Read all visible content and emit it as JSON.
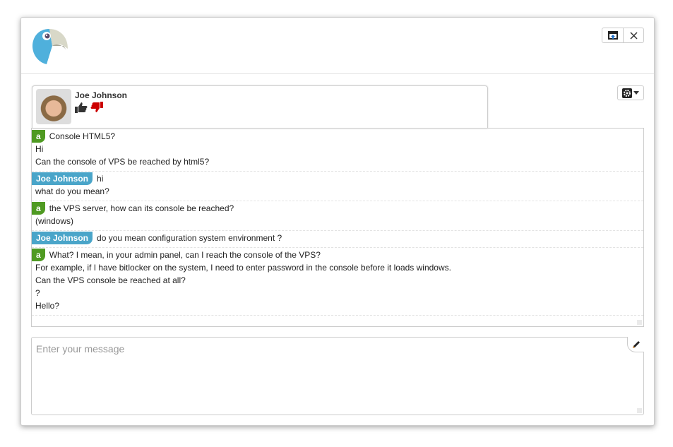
{
  "header": {
    "logo": "parrot-logo",
    "buttons": [
      {
        "icon": "popout-icon"
      },
      {
        "icon": "close-icon"
      }
    ]
  },
  "profile": {
    "name": "Joe Johnson",
    "thumbs_up": "thumbs-up-icon",
    "thumbs_down": "thumbs-down-icon"
  },
  "settings": {
    "icon": "gear-icon"
  },
  "colors": {
    "agent_tag": "#4f9a22",
    "user_tag": "#4aa5c9",
    "thumbs_down": "#cc0000"
  },
  "messages": [
    {
      "tag": "a",
      "first": "Console HTML5?",
      "lines": [
        "Hi",
        "Can the console of VPS be reached by html5?"
      ]
    },
    {
      "tag": "Joe Johnson",
      "first": "hi",
      "lines": [
        "what do you mean?"
      ]
    },
    {
      "tag": "a",
      "first": "the VPS server, how can its console be reached?",
      "lines": [
        "(windows)"
      ]
    },
    {
      "tag": "Joe Johnson",
      "first": "do you mean configuration system environment ?",
      "lines": []
    },
    {
      "tag": "a",
      "first": "What? I mean, in your admin panel, can I reach the console of the VPS?",
      "lines": [
        "For example, if I have bitlocker on the system, I need to enter password in the console before it loads windows.",
        "Can the VPS console be reached at all?",
        "?",
        "Hello?"
      ]
    }
  ],
  "composer": {
    "placeholder": "Enter your message",
    "icon": "pencil-icon"
  }
}
